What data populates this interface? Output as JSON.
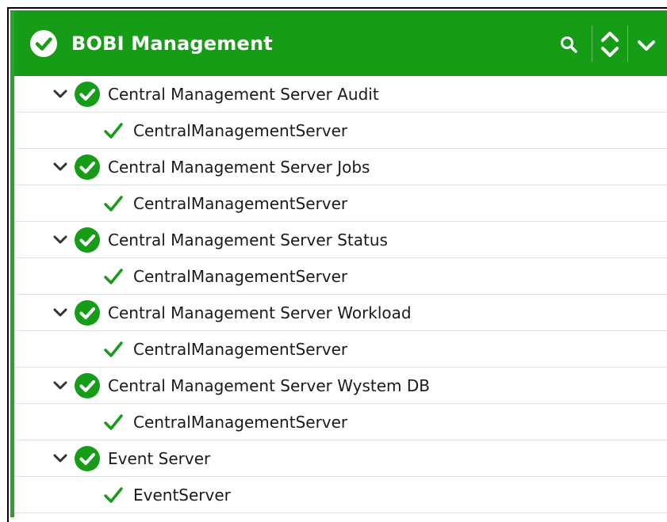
{
  "header": {
    "title": "BOBI Management",
    "status_icon": "check-circle-icon",
    "actions": [
      "search-icon",
      "sort-icon",
      "chevron-down-icon"
    ]
  },
  "colors": {
    "header_bg": "#169c16",
    "status_ok": "#169c16",
    "border": "#2ba22b"
  },
  "tree": [
    {
      "label": "Central Management Server Audit",
      "children": [
        "CentralManagementServer"
      ]
    },
    {
      "label": "Central Management Server Jobs",
      "children": [
        "CentralManagementServer"
      ]
    },
    {
      "label": "Central Management Server Status",
      "children": [
        "CentralManagementServer"
      ]
    },
    {
      "label": "Central Management Server Workload",
      "children": [
        "CentralManagementServer"
      ]
    },
    {
      "label": "Central Management Server Wystem DB",
      "children": [
        "CentralManagementServer"
      ]
    },
    {
      "label": "Event Server",
      "children": [
        "EventServer"
      ]
    }
  ]
}
